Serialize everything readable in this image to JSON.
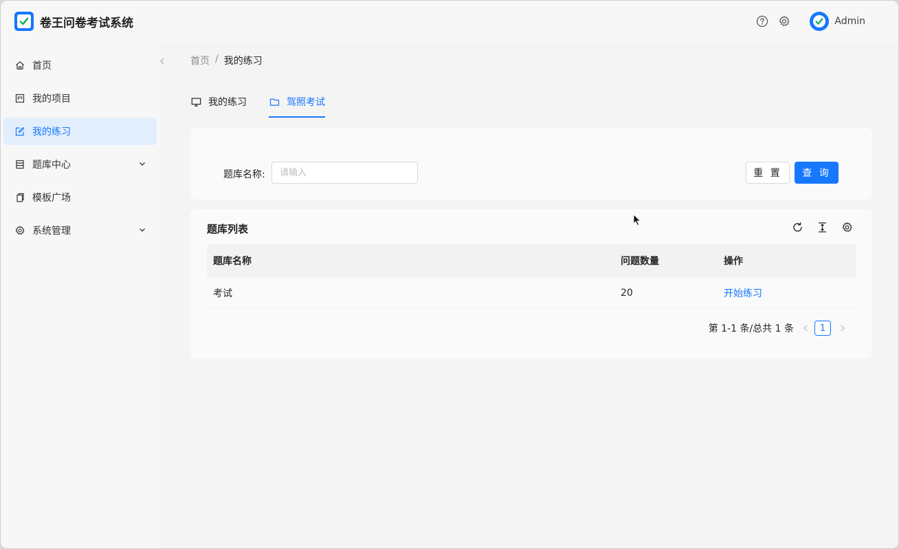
{
  "app": {
    "title": "卷王问卷考试系统"
  },
  "header": {
    "user_name": "Admin"
  },
  "sidebar": {
    "items": [
      {
        "label": "首页"
      },
      {
        "label": "我的项目"
      },
      {
        "label": "我的练习",
        "active": true
      },
      {
        "label": "题库中心"
      },
      {
        "label": "模板广场"
      },
      {
        "label": "系统管理"
      }
    ]
  },
  "breadcrumb": {
    "home": "首页",
    "separator": "/",
    "current": "我的练习"
  },
  "tabs": [
    {
      "label": "我的练习"
    },
    {
      "label": "驾照考试",
      "active": true
    }
  ],
  "search": {
    "label": "题库名称:",
    "placeholder": "请输入",
    "value": "",
    "reset_label": "重 置",
    "query_label": "查 询"
  },
  "table": {
    "title": "题库列表",
    "columns": [
      "题库名称",
      "问题数量",
      "操作"
    ],
    "rows": [
      {
        "name": "考试",
        "count": "20",
        "action": "开始练习"
      }
    ],
    "pagination": {
      "summary": "第 1-1 条/总共 1 条",
      "current_page": "1"
    }
  },
  "colors": {
    "primary": "#1677ff",
    "active_bg": "#e3eefc"
  }
}
